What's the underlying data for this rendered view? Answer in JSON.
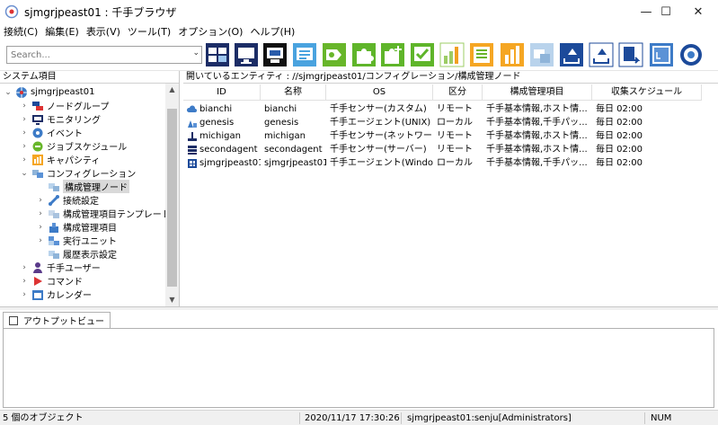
{
  "window": {
    "title": "sjmgrjpeast01 : 千手ブラウザ"
  },
  "window_controls": {
    "minimize": "—",
    "maximize": "☐",
    "close": "✕"
  },
  "menu": [
    "接続(C)",
    "編集(E)",
    "表示(V)",
    "ツール(T)",
    "オプション(O)",
    "ヘルプ(H)"
  ],
  "search": {
    "placeholder": "Search..."
  },
  "left_pane": {
    "header": "システム項目",
    "tree": [
      {
        "label": "sjmgrjpeast01",
        "expanded": true,
        "icon": "globe-icon"
      },
      {
        "label": "ノードグループ",
        "expanded": false,
        "icon": "node-group-icon"
      },
      {
        "label": "モニタリング",
        "expanded": false,
        "icon": "monitor-icon"
      },
      {
        "label": "イベント",
        "expanded": false,
        "icon": "event-icon"
      },
      {
        "label": "ジョブスケジュール",
        "expanded": false,
        "icon": "job-schedule-icon"
      },
      {
        "label": "キャパシティ",
        "expanded": false,
        "icon": "capacity-icon"
      },
      {
        "label": "コンフィグレーション",
        "expanded": true,
        "icon": "configuration-icon"
      },
      {
        "label": "構成管理ノード",
        "expanded": null,
        "selected": true,
        "icon": "config-node-icon"
      },
      {
        "label": "接続設定",
        "expanded": false,
        "icon": "connection-icon"
      },
      {
        "label": "構成管理項目テンプレート",
        "expanded": false,
        "icon": "template-icon"
      },
      {
        "label": "構成管理項目",
        "expanded": false,
        "icon": "config-item-icon"
      },
      {
        "label": "実行ユニット",
        "expanded": false,
        "icon": "exec-unit-icon"
      },
      {
        "label": "履歴表示設定",
        "expanded": null,
        "icon": "history-icon"
      },
      {
        "label": "千手ユーザー",
        "expanded": false,
        "icon": "user-icon"
      },
      {
        "label": "コマンド",
        "expanded": false,
        "icon": "command-icon"
      },
      {
        "label": "カレンダー",
        "expanded": false,
        "icon": "calendar-icon"
      }
    ]
  },
  "right_pane": {
    "path": "開いているエンティティ : //sjmgrjpeast01/コンフィグレーション/構成管理ノード",
    "columns": [
      "ID",
      "名称",
      "OS",
      "区分",
      "構成管理項目",
      "収集スケジュール"
    ],
    "rows": [
      {
        "icon": "cloud-icon",
        "id": "bianchi",
        "name": "bianchi",
        "os": "千手センサー(カスタム)",
        "kubun": "リモート",
        "items": "千手基本情報,ホスト情...",
        "schedule": "毎日 02:00"
      },
      {
        "icon": "agent-icon",
        "id": "genesis",
        "name": "genesis",
        "os": "千手エージェント(UNIX)",
        "kubun": "ローカル",
        "items": "千手基本情報,千手パッ...",
        "schedule": "毎日 02:00"
      },
      {
        "icon": "network-sensor-icon",
        "id": "michigan",
        "name": "michigan",
        "os": "千手センサー(ネットワーク)",
        "kubun": "リモート",
        "items": "千手基本情報,ホスト情...",
        "schedule": "毎日 02:00"
      },
      {
        "icon": "server-sensor-icon",
        "id": "secondagent",
        "name": "secondagent",
        "os": "千手センサー(サーバー)",
        "kubun": "リモート",
        "items": "千手基本情報,ホスト情...",
        "schedule": "毎日 02:00"
      },
      {
        "icon": "windows-agent-icon",
        "id": "sjmgrjpeast01",
        "name": "sjmgrjpeast01",
        "os": "千手エージェント(Windows)",
        "kubun": "ローカル",
        "items": "千手基本情報,千手パッ...",
        "schedule": "毎日 02:00"
      }
    ]
  },
  "output_pane": {
    "tab_label": "アウトプットビュー"
  },
  "status_bar": {
    "objects": "5 個のオブジェクト",
    "datetime": "2020/11/17 17:30:26",
    "user": "sjmgrjpeast01:senju[Administrators]",
    "num": "NUM"
  },
  "toolbar_icons": [
    "node-group-view-icon",
    "monitor-view-icon",
    "terminal-icon",
    "message-icon",
    "event-monitor-icon",
    "puzzle-icon",
    "puzzle-add-icon",
    "check-icon",
    "bar-chart-icon",
    "report-icon",
    "capacity-chart-icon",
    "config-icon",
    "export-icon",
    "export-all-icon",
    "export-file-icon",
    "log-icon",
    "schedule-icon"
  ]
}
